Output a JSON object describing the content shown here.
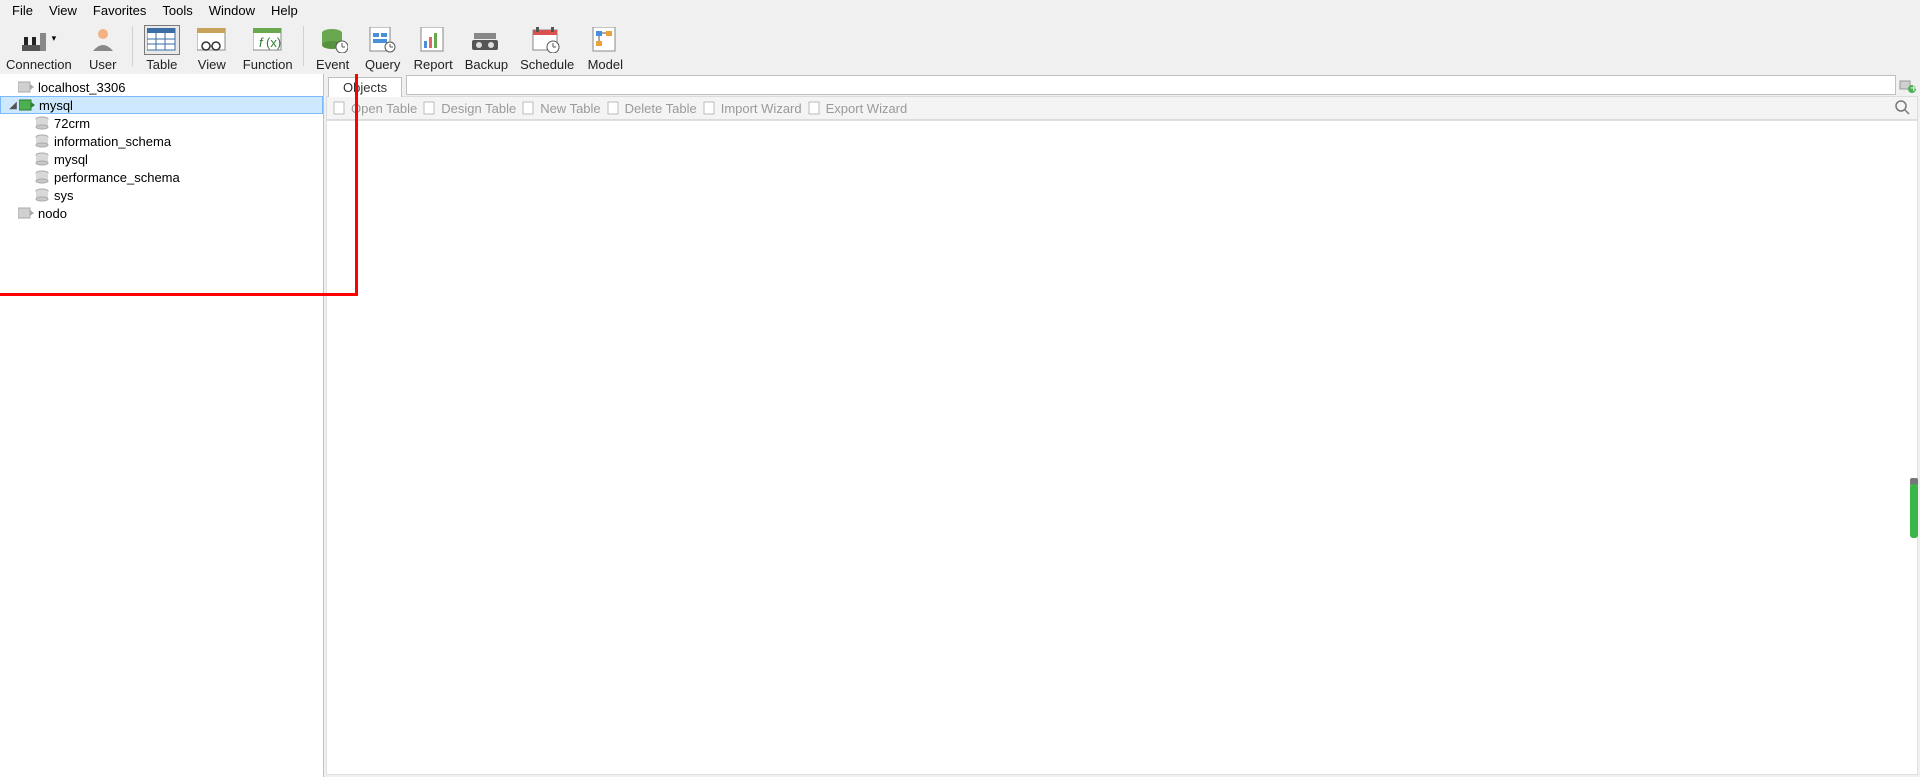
{
  "menu": {
    "items": [
      "File",
      "View",
      "Favorites",
      "Tools",
      "Window",
      "Help"
    ]
  },
  "toolbar": {
    "items": [
      {
        "label": "Connection",
        "icon": "plug"
      },
      {
        "label": "User",
        "icon": "user"
      },
      {
        "sep": true
      },
      {
        "label": "Table",
        "icon": "table",
        "selected": true
      },
      {
        "label": "View",
        "icon": "view"
      },
      {
        "label": "Function",
        "icon": "fx"
      },
      {
        "sep": true
      },
      {
        "label": "Event",
        "icon": "event"
      },
      {
        "label": "Query",
        "icon": "query"
      },
      {
        "label": "Report",
        "icon": "report"
      },
      {
        "label": "Backup",
        "icon": "backup"
      },
      {
        "label": "Schedule",
        "icon": "schedule"
      },
      {
        "label": "Model",
        "icon": "model"
      }
    ]
  },
  "tree": {
    "nodes": [
      {
        "label": "localhost_3306",
        "icon": "conn-off",
        "level": 1
      },
      {
        "label": "mysql",
        "icon": "conn-on",
        "level": 0,
        "expanded": true,
        "selected": true
      },
      {
        "label": "72crm",
        "icon": "db",
        "level": 2
      },
      {
        "label": "information_schema",
        "icon": "db",
        "level": 2
      },
      {
        "label": "mysql",
        "icon": "db",
        "level": 2
      },
      {
        "label": "performance_schema",
        "icon": "db",
        "level": 2
      },
      {
        "label": "sys",
        "icon": "db",
        "level": 2
      },
      {
        "label": "nodo",
        "icon": "conn-off",
        "level": 1
      }
    ]
  },
  "tabs": {
    "active": "Objects"
  },
  "subtoolbar": {
    "items": [
      {
        "label": "Open Table",
        "icon": "open"
      },
      {
        "label": "Design Table",
        "icon": "design"
      },
      {
        "label": "New Table",
        "icon": "new"
      },
      {
        "label": "Delete Table",
        "icon": "delete"
      },
      {
        "label": "Import Wizard",
        "icon": "import"
      },
      {
        "label": "Export Wizard",
        "icon": "export"
      }
    ]
  }
}
